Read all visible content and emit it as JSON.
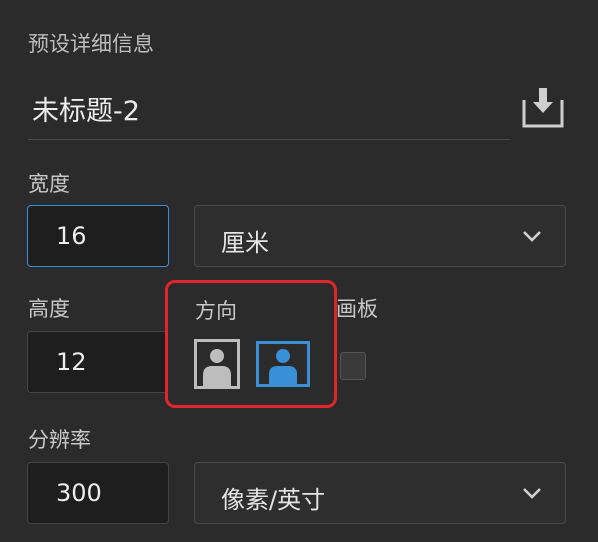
{
  "panel": {
    "title": "预设详细信息",
    "doc_name": "未标题-2",
    "save_icon": "save-preset-icon"
  },
  "width": {
    "label": "宽度",
    "value": "16",
    "unit": "厘米"
  },
  "height": {
    "label": "高度",
    "value": "12"
  },
  "orientation": {
    "label": "方向",
    "options": [
      {
        "name": "portrait",
        "icon": "portrait-icon",
        "selected": false
      },
      {
        "name": "landscape",
        "icon": "landscape-icon",
        "selected": true
      }
    ]
  },
  "artboard": {
    "label": "画板",
    "checked": false
  },
  "resolution": {
    "label": "分辨率",
    "value": "300",
    "unit": "像素/英寸"
  },
  "colors": {
    "accent": "#3a8fd9",
    "highlight": "#e0262a",
    "background": "#2b2b2b"
  }
}
